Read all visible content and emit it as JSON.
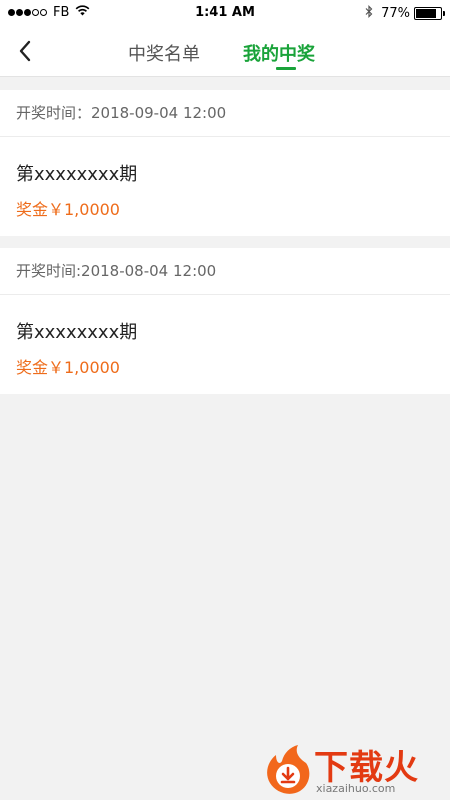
{
  "status_bar": {
    "carrier": "FB",
    "time": "1:41 AM",
    "battery": "77%"
  },
  "nav": {
    "tabs": [
      {
        "label": "中奖名单"
      },
      {
        "label": "我的中奖"
      }
    ],
    "active_tab": "我的中奖"
  },
  "records": [
    {
      "time": "开奖时间：2018-09-04 12:00",
      "issue": "第xxxxxxxx期",
      "prize": "奖金￥1,0000"
    },
    {
      "time": "开奖时间:2018-08-04 12:00",
      "issue": "第xxxxxxxx期",
      "prize": "奖金￥1,0000"
    }
  ],
  "watermark": {
    "text": "下载火",
    "url": "xiazaihuo.com"
  },
  "colors": {
    "accent_green": "#1aa33a",
    "prize_orange": "#ee6c1b",
    "background": "#f2f2f2"
  },
  "icons": [
    "signal-dots-icon",
    "wifi-icon",
    "bluetooth-icon",
    "battery-icon",
    "back-arrow-icon",
    "download-flame-icon"
  ]
}
